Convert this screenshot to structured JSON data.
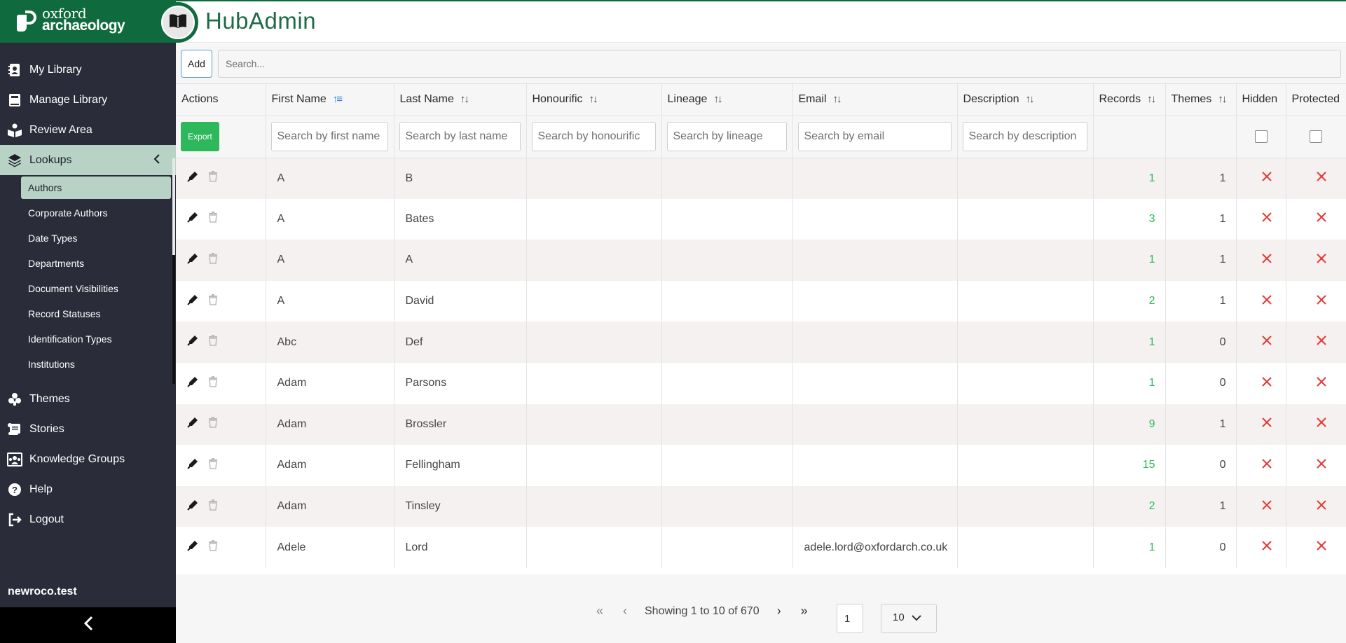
{
  "brand": {
    "line1": "oxford",
    "line2": "archaeology"
  },
  "app": {
    "title": "HubAdmin"
  },
  "sidebar": {
    "items": [
      {
        "label": "My Library",
        "icon": "library-user-icon"
      },
      {
        "label": "Manage Library",
        "icon": "book-icon"
      },
      {
        "label": "Review Area",
        "icon": "reader-icon"
      },
      {
        "label": "Lookups",
        "icon": "layers-icon",
        "active": true
      }
    ],
    "subitems": [
      {
        "label": "Authors",
        "active": true
      },
      {
        "label": "Corporate Authors"
      },
      {
        "label": "Date Types"
      },
      {
        "label": "Departments"
      },
      {
        "label": "Document Visibilities"
      },
      {
        "label": "Record Statuses"
      },
      {
        "label": "Identification Types"
      },
      {
        "label": "Institutions"
      }
    ],
    "bottom_items": [
      {
        "label": "Themes",
        "icon": "puzzle-icon"
      },
      {
        "label": "Stories",
        "icon": "scroll-icon"
      },
      {
        "label": "Knowledge Groups",
        "icon": "group-icon"
      },
      {
        "label": "Help",
        "icon": "help-icon"
      },
      {
        "label": "Logout",
        "icon": "logout-icon"
      }
    ],
    "hostname": "newroco.test"
  },
  "toolbar": {
    "add_label": "Add",
    "search_placeholder": "Search..."
  },
  "table": {
    "headers": {
      "actions": "Actions",
      "first_name": "First Name",
      "last_name": "Last Name",
      "honourific": "Honourific",
      "lineage": "Lineage",
      "email": "Email",
      "description": "Description",
      "records": "Records",
      "themes": "Themes",
      "hidden": "Hidden",
      "protected": "Protected"
    },
    "export_label": "Export",
    "filters": {
      "first_name": "Search by first name",
      "last_name": "Search by last name",
      "honourific": "Search by honourific",
      "lineage": "Search by lineage",
      "email": "Search by email",
      "description": "Search by description"
    },
    "rows": [
      {
        "first": "A",
        "last": "B",
        "honourific": "",
        "lineage": "",
        "email": "",
        "description": "",
        "records": "1",
        "themes": "1"
      },
      {
        "first": "A",
        "last": "Bates",
        "honourific": "",
        "lineage": "",
        "email": "",
        "description": "",
        "records": "3",
        "themes": "1"
      },
      {
        "first": "A",
        "last": "A",
        "honourific": "",
        "lineage": "",
        "email": "",
        "description": "",
        "records": "1",
        "themes": "1"
      },
      {
        "first": "A",
        "last": "David",
        "honourific": "",
        "lineage": "",
        "email": "",
        "description": "",
        "records": "2",
        "themes": "1"
      },
      {
        "first": "Abc",
        "last": "Def",
        "honourific": "",
        "lineage": "",
        "email": "",
        "description": "",
        "records": "1",
        "themes": "0"
      },
      {
        "first": "Adam",
        "last": "Parsons",
        "honourific": "",
        "lineage": "",
        "email": "",
        "description": "",
        "records": "1",
        "themes": "0"
      },
      {
        "first": "Adam",
        "last": "Brossler",
        "honourific": "",
        "lineage": "",
        "email": "",
        "description": "",
        "records": "9",
        "themes": "1"
      },
      {
        "first": "Adam",
        "last": "Fellingham",
        "honourific": "",
        "lineage": "",
        "email": "",
        "description": "",
        "records": "15",
        "themes": "0"
      },
      {
        "first": "Adam",
        "last": "Tinsley",
        "honourific": "",
        "lineage": "",
        "email": "",
        "description": "",
        "records": "2",
        "themes": "1"
      },
      {
        "first": "Adele",
        "last": "Lord",
        "honourific": "",
        "lineage": "",
        "email": "adele.lord@oxfordarch.co.uk",
        "description": "",
        "records": "1",
        "themes": "0"
      }
    ]
  },
  "pagination": {
    "info": "Showing 1 to 10 of 670",
    "page": "1",
    "page_size": "10"
  },
  "colors": {
    "brand_green": "#0f6b3e",
    "sidebar_bg": "#2b2c3a",
    "active_bg": "#b8d3c5",
    "accent_green": "#2eb85c",
    "x_red": "#e53935"
  }
}
